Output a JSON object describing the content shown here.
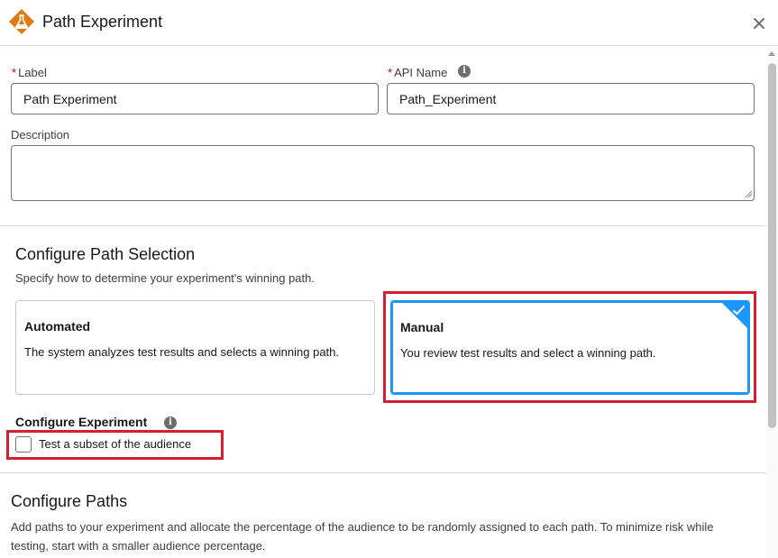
{
  "header": {
    "title": "Path Experiment",
    "app_icon": "flask-icon",
    "close_icon": "close-icon",
    "accent_color": "#e07a16"
  },
  "form": {
    "label": {
      "text": "Label",
      "required": "*",
      "value": "Path Experiment"
    },
    "api_name": {
      "text": "API Name",
      "required": "*",
      "value": "Path_Experiment"
    },
    "description": {
      "text": "Description",
      "value": ""
    }
  },
  "path_selection": {
    "title": "Configure Path Selection",
    "help": "Specify how to determine your experiment's winning path.",
    "options": [
      {
        "title": "Automated",
        "desc": "The system analyzes test results and selects a winning path.",
        "selected": false
      },
      {
        "title": "Manual",
        "desc": "You review test results and select a winning path.",
        "selected": true
      }
    ],
    "selected_color": "#1b96ff"
  },
  "experiment": {
    "title": "Configure Experiment",
    "checkbox_label": "Test a subset of the audience",
    "checked": false
  },
  "paths": {
    "title": "Configure Paths",
    "help": "Add paths to your experiment and allocate the percentage of the audience to be randomly assigned to each path. To minimize risk while testing, start with a smaller audience percentage."
  },
  "annotation_color": "#d32030"
}
